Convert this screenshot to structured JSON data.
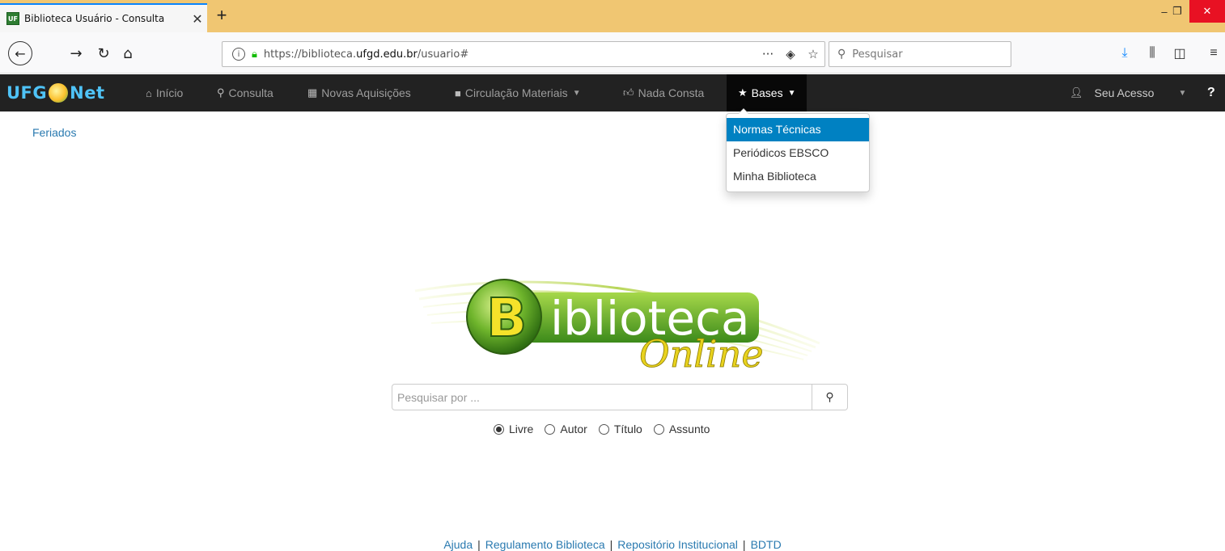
{
  "browser": {
    "tab_title": "Biblioteca Usuário - Consulta",
    "tab_favicon": "UF",
    "url_prefix": "https://biblioteca.",
    "url_domain": "ufgd.edu.br",
    "url_suffix": "/usuario#",
    "search_placeholder": "Pesquisar"
  },
  "navbar": {
    "brand_left": "UFG",
    "brand_right": "Net",
    "items": [
      {
        "label": "Início",
        "icon": "home-icon"
      },
      {
        "label": "Consulta",
        "icon": "search-icon"
      },
      {
        "label": "Novas Aquisições",
        "icon": "gift-icon"
      },
      {
        "label": "Circulação Materiais",
        "icon": "book-icon"
      },
      {
        "label": "Nada Consta",
        "icon": "thumbs-up-icon"
      },
      {
        "label": "Bases",
        "icon": "star-icon"
      }
    ],
    "user_label": "Seu Acesso",
    "help_label": "?"
  },
  "dropdown": {
    "items": [
      "Normas Técnicas",
      "Periódicos EBSCO",
      "Minha Biblioteca"
    ]
  },
  "content": {
    "feriados": "Feriados",
    "logo_letter": "B",
    "logo_text": "iblioteca",
    "logo_script": "Online",
    "search_placeholder": "Pesquisar por ...",
    "radio_options": [
      "Livre",
      "Autor",
      "Título",
      "Assunto"
    ],
    "radio_selected": "Livre"
  },
  "footer": {
    "links": [
      "Ajuda",
      "Regulamento Biblioteca",
      "Repositório Institucional",
      "BDTD"
    ],
    "separator": "|"
  }
}
